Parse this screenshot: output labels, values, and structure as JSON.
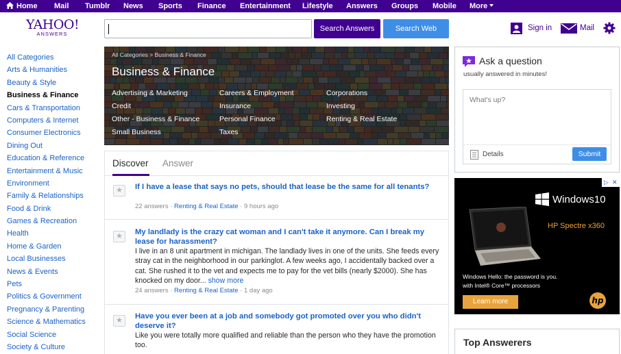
{
  "nav": {
    "items": [
      "Home",
      "Mail",
      "Tumblr",
      "News",
      "Sports",
      "Finance",
      "Entertainment",
      "Lifestyle",
      "Answers",
      "Groups",
      "Mobile",
      "More"
    ]
  },
  "logo": {
    "brand": "YAHOO!",
    "sub": "ANSWERS"
  },
  "search": {
    "value": "",
    "search_answers_label": "Search Answers",
    "search_web_label": "Search Web"
  },
  "header": {
    "signin_label": "Sign in",
    "mail_label": "Mail"
  },
  "sidebar": {
    "categories": [
      "All Categories",
      "Arts & Humanities",
      "Beauty & Style",
      "Business & Finance",
      "Cars & Transportation",
      "Computers & Internet",
      "Consumer Electronics",
      "Dining Out",
      "Education & Reference",
      "Entertainment & Music",
      "Environment",
      "Family & Relationships",
      "Food & Drink",
      "Games & Recreation",
      "Health",
      "Home & Garden",
      "Local Businesses",
      "News & Events",
      "Pets",
      "Politics & Government",
      "Pregnancy & Parenting",
      "Science & Mathematics",
      "Social Science",
      "Society & Culture"
    ],
    "active": "Business & Finance"
  },
  "banner": {
    "breadcrumb": "All Categories > Business & Finance",
    "title": "Business & Finance",
    "subcategories": [
      "Advertising & Marketing",
      "Careers & Employment",
      "Corporations",
      "Credit",
      "Insurance",
      "Investing",
      "Other - Business & Finance",
      "Personal Finance",
      "Renting & Real Estate",
      "Small Business",
      "Taxes"
    ]
  },
  "feed": {
    "tabs": [
      "Discover",
      "Answer"
    ],
    "questions": [
      {
        "title": "If I have a lease that says no pets, should that lease be the same for all tenants?",
        "body": "",
        "more": "",
        "answers": "22 answers",
        "category": "Renting & Real Estate",
        "time": "9 hours ago"
      },
      {
        "title": "My landlady is the crazy cat woman and I can't take it anymore. Can I break my lease for harassment?",
        "body": "I live in an 8 unit apartment in michigan. The landlady lives in one of the units. She feeds every stray cat in the neighborhood in our parkinglot. A few weeks ago, I accidentally backed over a cat. She rushed it to the vet and expects me to pay for the vet bills (nearly $2000). She has knocked on my door...",
        "more": "show more",
        "answers": "24 answers",
        "category": "Renting & Real Estate",
        "time": "1 day ago"
      },
      {
        "title": "Have you ever been at a job and somebody got promoted over you who didn't deserve it?",
        "body": "Like you were totally more qualified and reliable than the person who they have the promotion too.",
        "more": "",
        "answers": "",
        "category": "",
        "time": ""
      }
    ]
  },
  "ask": {
    "title": "Ask a question",
    "subtitle": "usually answered in minutes!",
    "placeholder": "What's up?",
    "details_label": "Details",
    "submit_label": "Submit"
  },
  "ad": {
    "windows": "Windows10",
    "product": "HP Spectre x360",
    "line1": "Windows Hello: the password is you.",
    "line2": "with Intel® Core™ processors",
    "cta": "Learn more",
    "brand_mark": "hp"
  },
  "top_answerers": {
    "title": "Top Answerers"
  },
  "colors": {
    "brand": "#400090",
    "link": "#1a61c7",
    "button_blue": "#3e8ee8",
    "ad_accent": "#e8a43c"
  }
}
